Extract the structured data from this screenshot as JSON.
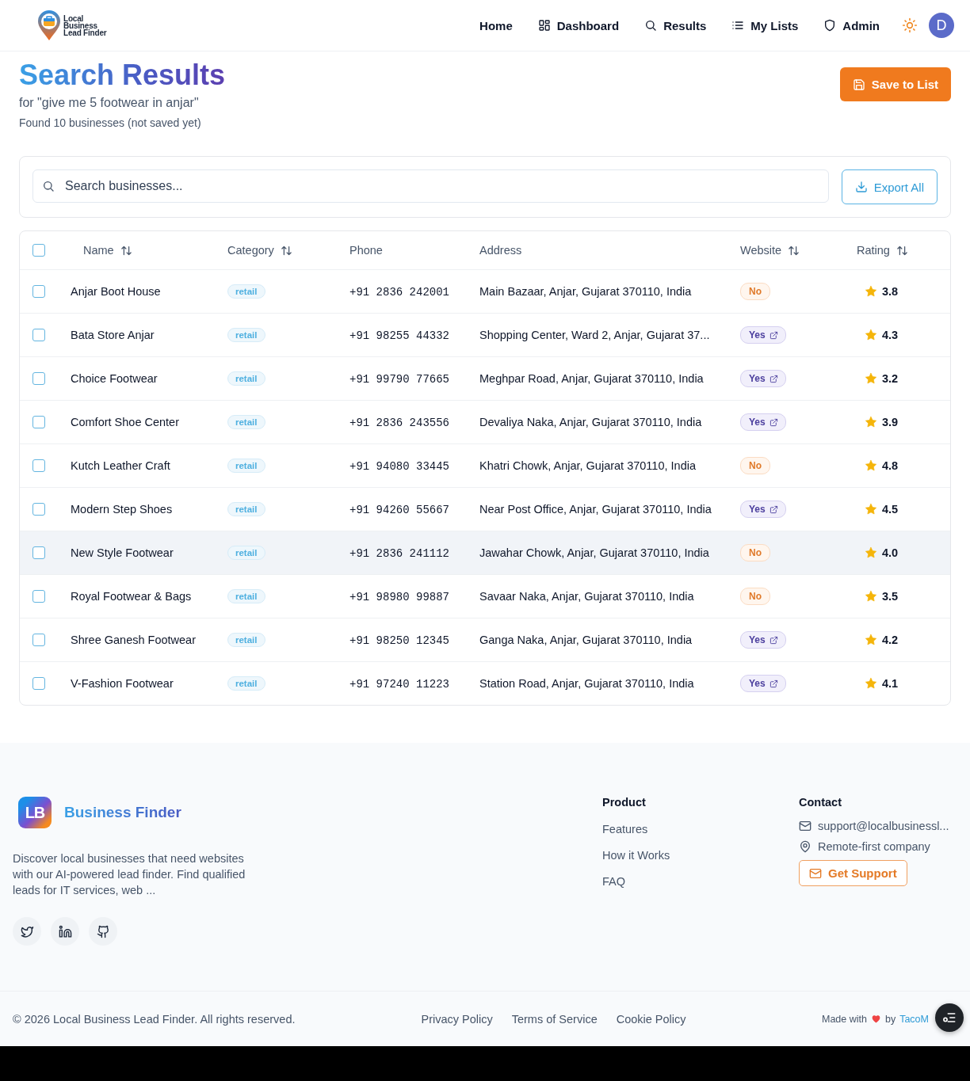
{
  "header": {
    "logo_text": "Local\nBusiness\nLead Finder",
    "nav": [
      {
        "label": "Home"
      },
      {
        "label": "Dashboard"
      },
      {
        "label": "Results"
      },
      {
        "label": "My Lists"
      },
      {
        "label": "Admin"
      }
    ],
    "avatar": "D"
  },
  "page": {
    "title": "Search Results",
    "query": "for \"give me 5 footwear in anjar\"",
    "summary": "Found 10 businesses (not saved yet)",
    "save_button": "Save to List"
  },
  "search": {
    "placeholder": "Search businesses...",
    "export_button": "Export All"
  },
  "table": {
    "all_checked": false,
    "columns": [
      {
        "label": "Name",
        "sortable": true
      },
      {
        "label": "Category",
        "sortable": true
      },
      {
        "label": "Phone",
        "sortable": false
      },
      {
        "label": "Address",
        "sortable": false
      },
      {
        "label": "Website",
        "sortable": true
      },
      {
        "label": "Rating",
        "sortable": true
      }
    ],
    "rows": [
      {
        "checked": false,
        "hovered": false,
        "name": "Anjar Boot House",
        "category": "retail",
        "phone": "+91 2836 242001",
        "address": "Main Bazaar, Anjar, Gujarat 370110, India",
        "website": {
          "label": "No",
          "available": false
        },
        "rating": "3.8"
      },
      {
        "checked": false,
        "hovered": false,
        "name": "Bata Store Anjar",
        "category": "retail",
        "phone": "+91 98255 44332",
        "address": "Shopping Center, Ward 2, Anjar, Gujarat 37...",
        "website": {
          "label": "Yes",
          "available": true
        },
        "rating": "4.3"
      },
      {
        "checked": false,
        "hovered": false,
        "name": "Choice Footwear",
        "category": "retail",
        "phone": "+91 99790 77665",
        "address": "Meghpar Road, Anjar, Gujarat 370110, India",
        "website": {
          "label": "Yes",
          "available": true
        },
        "rating": "3.2"
      },
      {
        "checked": false,
        "hovered": false,
        "name": "Comfort Shoe Center",
        "category": "retail",
        "phone": "+91 2836 243556",
        "address": "Devaliya Naka, Anjar, Gujarat 370110, India",
        "website": {
          "label": "Yes",
          "available": true
        },
        "rating": "3.9"
      },
      {
        "checked": false,
        "hovered": false,
        "name": "Kutch Leather Craft",
        "category": "retail",
        "phone": "+91 94080 33445",
        "address": "Khatri Chowk, Anjar, Gujarat 370110, India",
        "website": {
          "label": "No",
          "available": false
        },
        "rating": "4.8"
      },
      {
        "checked": false,
        "hovered": false,
        "name": "Modern Step Shoes",
        "category": "retail",
        "phone": "+91 94260 55667",
        "address": "Near Post Office, Anjar, Gujarat 370110, India",
        "website": {
          "label": "Yes",
          "available": true
        },
        "rating": "4.5"
      },
      {
        "checked": false,
        "hovered": true,
        "name": "New Style Footwear",
        "category": "retail",
        "phone": "+91 2836 241112",
        "address": "Jawahar Chowk, Anjar, Gujarat 370110, India",
        "website": {
          "label": "No",
          "available": false
        },
        "rating": "4.0"
      },
      {
        "checked": false,
        "hovered": false,
        "name": "Royal Footwear & Bags",
        "category": "retail",
        "phone": "+91 98980 99887",
        "address": "Savaar Naka, Anjar, Gujarat 370110, India",
        "website": {
          "label": "No",
          "available": false
        },
        "rating": "3.5"
      },
      {
        "checked": false,
        "hovered": false,
        "name": "Shree Ganesh Footwear",
        "category": "retail",
        "phone": "+91 98250 12345",
        "address": "Ganga Naka, Anjar, Gujarat 370110, India",
        "website": {
          "label": "Yes",
          "available": true
        },
        "rating": "4.2"
      },
      {
        "checked": false,
        "hovered": false,
        "name": "V-Fashion Footwear",
        "category": "retail",
        "phone": "+91 97240 11223",
        "address": "Station Road, Anjar, Gujarat 370110, India",
        "website": {
          "label": "Yes",
          "available": true
        },
        "rating": "4.1"
      }
    ]
  },
  "footer": {
    "logo_mark": "LB",
    "brand": "Business Finder",
    "description": "Discover local businesses that need websites with our AI-powered lead finder. Find qualified leads for IT services, web ...",
    "product": {
      "heading": "Product",
      "links": [
        "Features",
        "How it Works",
        "FAQ"
      ]
    },
    "contact": {
      "heading": "Contact",
      "email": "support@localbusinessl...",
      "location": "Remote-first company",
      "button": "Get Support"
    },
    "copyright": "© 2026 Local Business Lead Finder. All rights reserved.",
    "legal_links": [
      "Privacy Policy",
      "Terms of Service",
      "Cookie Policy"
    ],
    "made_with": "Made with",
    "by": "by",
    "author": "TacoM"
  }
}
